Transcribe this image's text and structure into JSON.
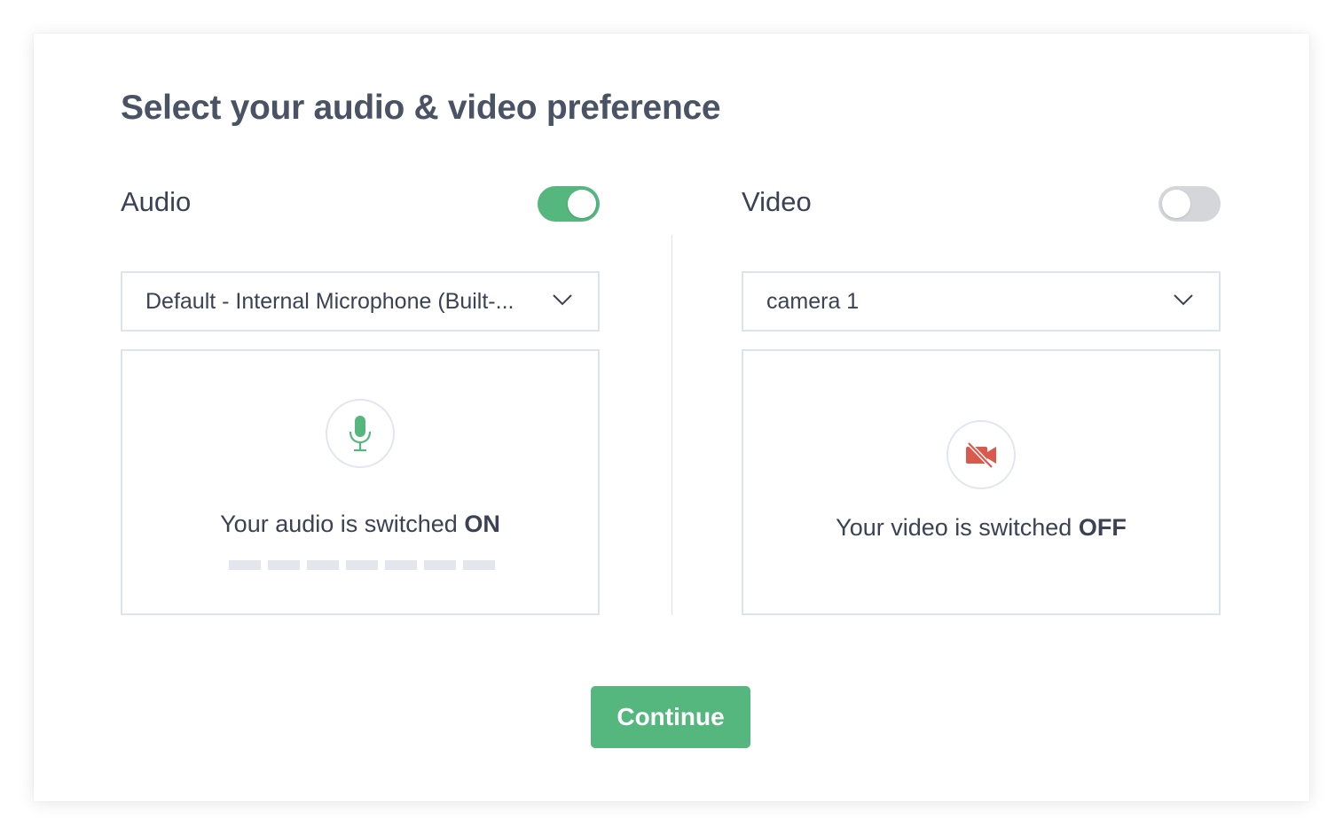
{
  "dialog": {
    "title": "Select your audio & video preference",
    "continue_label": "Continue"
  },
  "audio": {
    "label": "Audio",
    "enabled": true,
    "device_selected": "Default - Internal Microphone (Built-...",
    "status_prefix": "Your audio is switched ",
    "status_value": "ON",
    "icon": "microphone-icon",
    "level_bars": 7
  },
  "video": {
    "label": "Video",
    "enabled": false,
    "device_selected": "camera 1",
    "status_prefix": "Your video is switched ",
    "status_value": "OFF",
    "icon": "video-off-icon"
  },
  "colors": {
    "accent_green": "#55b77e",
    "video_off_red": "#d9594c",
    "toggle_off": "#d4d6da",
    "text_dark": "#3a4254"
  }
}
